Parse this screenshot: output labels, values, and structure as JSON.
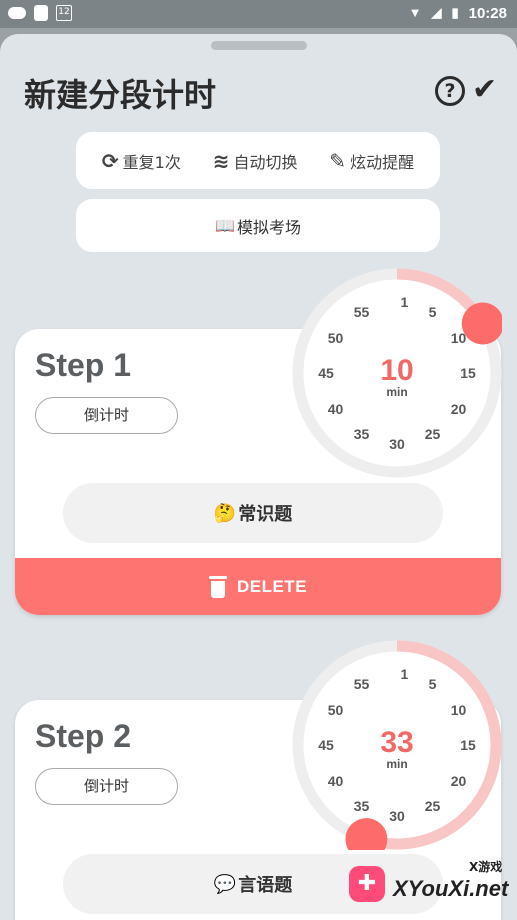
{
  "status_bar": {
    "calendar_day": "12",
    "time": "10:28"
  },
  "header": {
    "title": "新建分段计时"
  },
  "options": [
    {
      "icon": "repeat-icon",
      "label": "重复1次"
    },
    {
      "icon": "layers-icon",
      "label": "自动切换"
    },
    {
      "icon": "magic-wand-icon",
      "label": "炫动提醒"
    }
  ],
  "mock_exam": {
    "emoji": "📖",
    "label": "模拟考场"
  },
  "steps": [
    {
      "title": "Step 1",
      "mode": "倒计时",
      "minutes": "10",
      "unit": "min",
      "category_emoji": "🤔",
      "category": "常识题",
      "delete_label": "DELETE",
      "progress_fraction": 0.1667
    },
    {
      "title": "Step 2",
      "mode": "倒计时",
      "minutes": "33",
      "unit": "min",
      "category_emoji": "💬",
      "category": "言语题",
      "progress_fraction": 0.55
    }
  ],
  "dial_numbers": [
    "1",
    "5",
    "10",
    "15",
    "20",
    "25",
    "30",
    "35",
    "40",
    "45",
    "50",
    "55"
  ],
  "watermark": {
    "main": "XYouXi.net",
    "sub": "X游戏"
  },
  "colors": {
    "accent": "#fe7470",
    "dial_progress": "#f9c6c6",
    "dial_track": "#eeeeee",
    "knob": "#fe6b6b"
  }
}
